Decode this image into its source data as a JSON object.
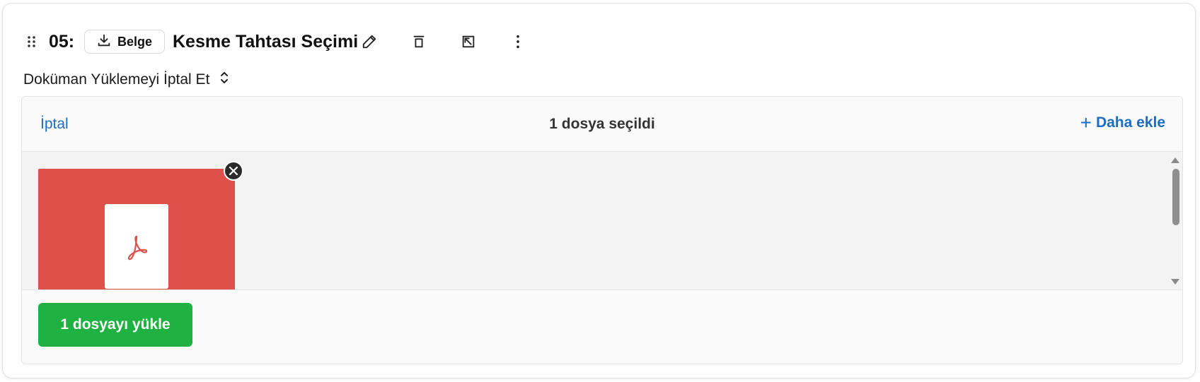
{
  "step": {
    "number": "05:",
    "type_badge": "Belge",
    "title": "Kesme Tahtası Seçimi",
    "icons": {
      "drag": "drag-handle-icon",
      "download": "download-icon",
      "edit": "pencil-icon",
      "delete": "trash-icon",
      "open": "open-external-icon",
      "more": "more-vertical-icon"
    }
  },
  "cancel_select": {
    "label": "Doküman Yüklemeyi İptal Et",
    "icon": "chevron-up-down-icon"
  },
  "uploader": {
    "cancel_label": "İptal",
    "count_label": "1 dosya seçildi",
    "add_more_label": "Daha ekle",
    "add_more_icon": "+",
    "files": [
      {
        "type": "pdf",
        "thumb_color": "#e0504a",
        "icon": "pdf-icon"
      }
    ],
    "upload_button_label": "1 dosyayı yükle",
    "colors": {
      "link": "#1b6ec2",
      "upload_button": "#1fb141"
    }
  }
}
